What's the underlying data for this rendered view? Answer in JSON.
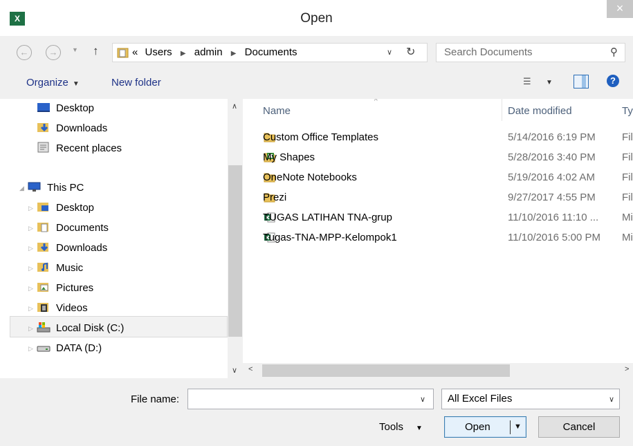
{
  "window": {
    "title": "Open",
    "app_icon": "X",
    "close_label": "×"
  },
  "nav": {
    "back_glyph": "←",
    "forward_glyph": "→",
    "up_glyph": "↑",
    "breadcrumb": [
      "«",
      "Users",
      "admin",
      "Documents"
    ],
    "search_placeholder": "Search Documents"
  },
  "toolbar": {
    "organize_label": "Organize",
    "new_folder_label": "New folder",
    "help_label": "?"
  },
  "sidebar": {
    "favorites": [
      {
        "label": "Desktop",
        "icon": "desktop-icon"
      },
      {
        "label": "Downloads",
        "icon": "downloads-icon"
      },
      {
        "label": "Recent places",
        "icon": "recent-places-icon"
      }
    ],
    "this_pc_label": "This PC",
    "pc_items": [
      {
        "label": "Desktop",
        "icon": "desktop-folder-icon"
      },
      {
        "label": "Documents",
        "icon": "documents-folder-icon"
      },
      {
        "label": "Downloads",
        "icon": "downloads-folder-icon"
      },
      {
        "label": "Music",
        "icon": "music-folder-icon"
      },
      {
        "label": "Pictures",
        "icon": "pictures-folder-icon"
      },
      {
        "label": "Videos",
        "icon": "videos-folder-icon"
      },
      {
        "label": "Local Disk (C:)",
        "icon": "drive-c-icon"
      },
      {
        "label": "DATA (D:)",
        "icon": "drive-d-icon"
      }
    ],
    "selected": "Local Disk (C:)"
  },
  "file_list": {
    "columns": [
      "Name",
      "Date modified",
      "Ty"
    ],
    "rows": [
      {
        "name": "Custom Office Templates",
        "date": "5/14/2016 6:19 PM",
        "type": "Fil",
        "icon": "folder-icon"
      },
      {
        "name": "My Shapes",
        "date": "5/28/2016 3:40 PM",
        "type": "Fil",
        "icon": "shapes-folder-icon"
      },
      {
        "name": "OneNote Notebooks",
        "date": "5/19/2016 4:02 AM",
        "type": "Fil",
        "icon": "folder-icon"
      },
      {
        "name": "Prezi",
        "date": "9/27/2017 4:55 PM",
        "type": "Fil",
        "icon": "folder-icon"
      },
      {
        "name": "TUGAS LATIHAN TNA-grup",
        "date": "11/10/2016 11:10 ...",
        "type": "Mi",
        "icon": "excel-file-icon"
      },
      {
        "name": "Tugas-TNA-MPP-Kelompok1",
        "date": "11/10/2016 5:00 PM",
        "type": "Mi",
        "icon": "excel-file-icon"
      }
    ]
  },
  "footer": {
    "file_name_label": "File name:",
    "file_name_value": "",
    "file_type_value": "All Excel Files",
    "tools_label": "Tools",
    "open_label": "Open",
    "cancel_label": "Cancel"
  },
  "colors": {
    "accent": "#1e3287",
    "excel_green": "#1e7145",
    "folder_yellow": "#e8c15a",
    "selection": "#e5f1fb"
  }
}
